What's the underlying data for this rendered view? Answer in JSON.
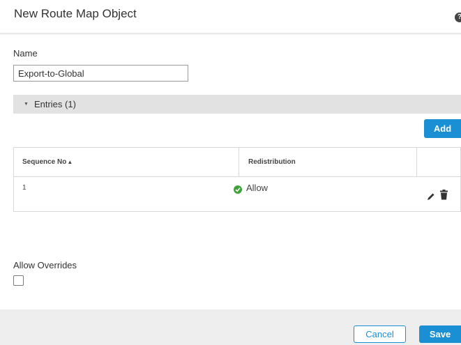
{
  "dialog": {
    "title": "New Route Map Object",
    "help_icon": "help-icon",
    "help_glyph": "?"
  },
  "name_field": {
    "label": "Name",
    "value": "Export-to-Global"
  },
  "entries": {
    "section_label": "Entries (1)",
    "expanded": true,
    "caret_glyph": "▼",
    "add_label": "Add",
    "columns": [
      {
        "label": "Sequence No",
        "sort_glyph": "▲"
      },
      {
        "label": "Redistribution"
      },
      {
        "label": ""
      }
    ],
    "rows": [
      {
        "sequence": "1",
        "redistribution": "Allow",
        "status_icon": "check-circle-icon",
        "actions": [
          "pencil-icon",
          "trash-icon"
        ]
      }
    ]
  },
  "overrides": {
    "label": "Allow Overrides",
    "checked": false
  },
  "footer": {
    "cancel_label": "Cancel",
    "save_label": "Save"
  },
  "colors": {
    "primary": "#1a8fd3",
    "allow": "#3fa33a",
    "section_bar": "#e2e2e2",
    "footer": "#eeeeee"
  }
}
